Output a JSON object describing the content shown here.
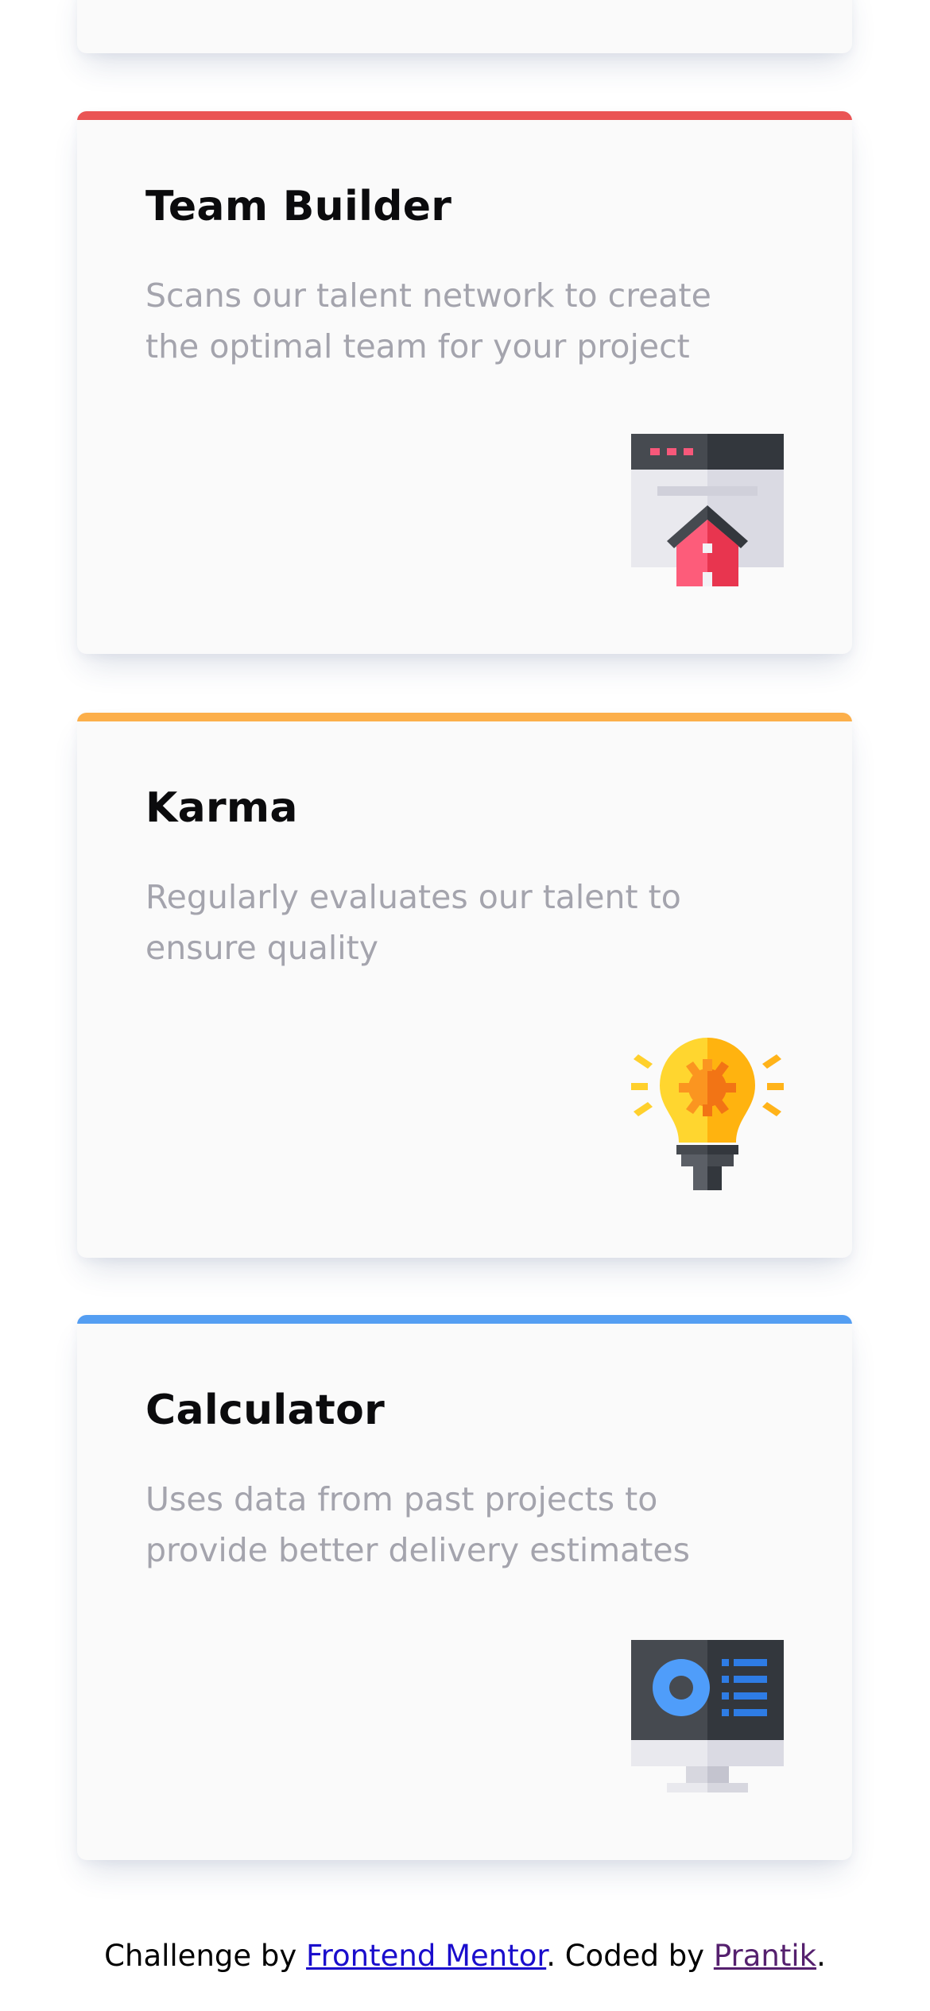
{
  "cards": [
    {
      "title": "Team Builder",
      "description": "Scans our talent network to create\nthe optimal team for your project",
      "accent_color": "#ea5454",
      "icon": "team-builder-icon"
    },
    {
      "title": "Karma",
      "description": "Regularly evaluates our talent to\nensure quality",
      "accent_color": "#fcaf4a",
      "icon": "karma-lightbulb-icon"
    },
    {
      "title": "Calculator",
      "description": "Uses data from past projects to\nprovide better delivery estimates",
      "accent_color": "#549ef2",
      "icon": "calculator-monitor-icon"
    }
  ],
  "footer": {
    "prefix": "Challenge by ",
    "link1": "Frontend Mentor",
    "middle": ". Coded by ",
    "link2": "Prantik",
    "suffix": "."
  }
}
